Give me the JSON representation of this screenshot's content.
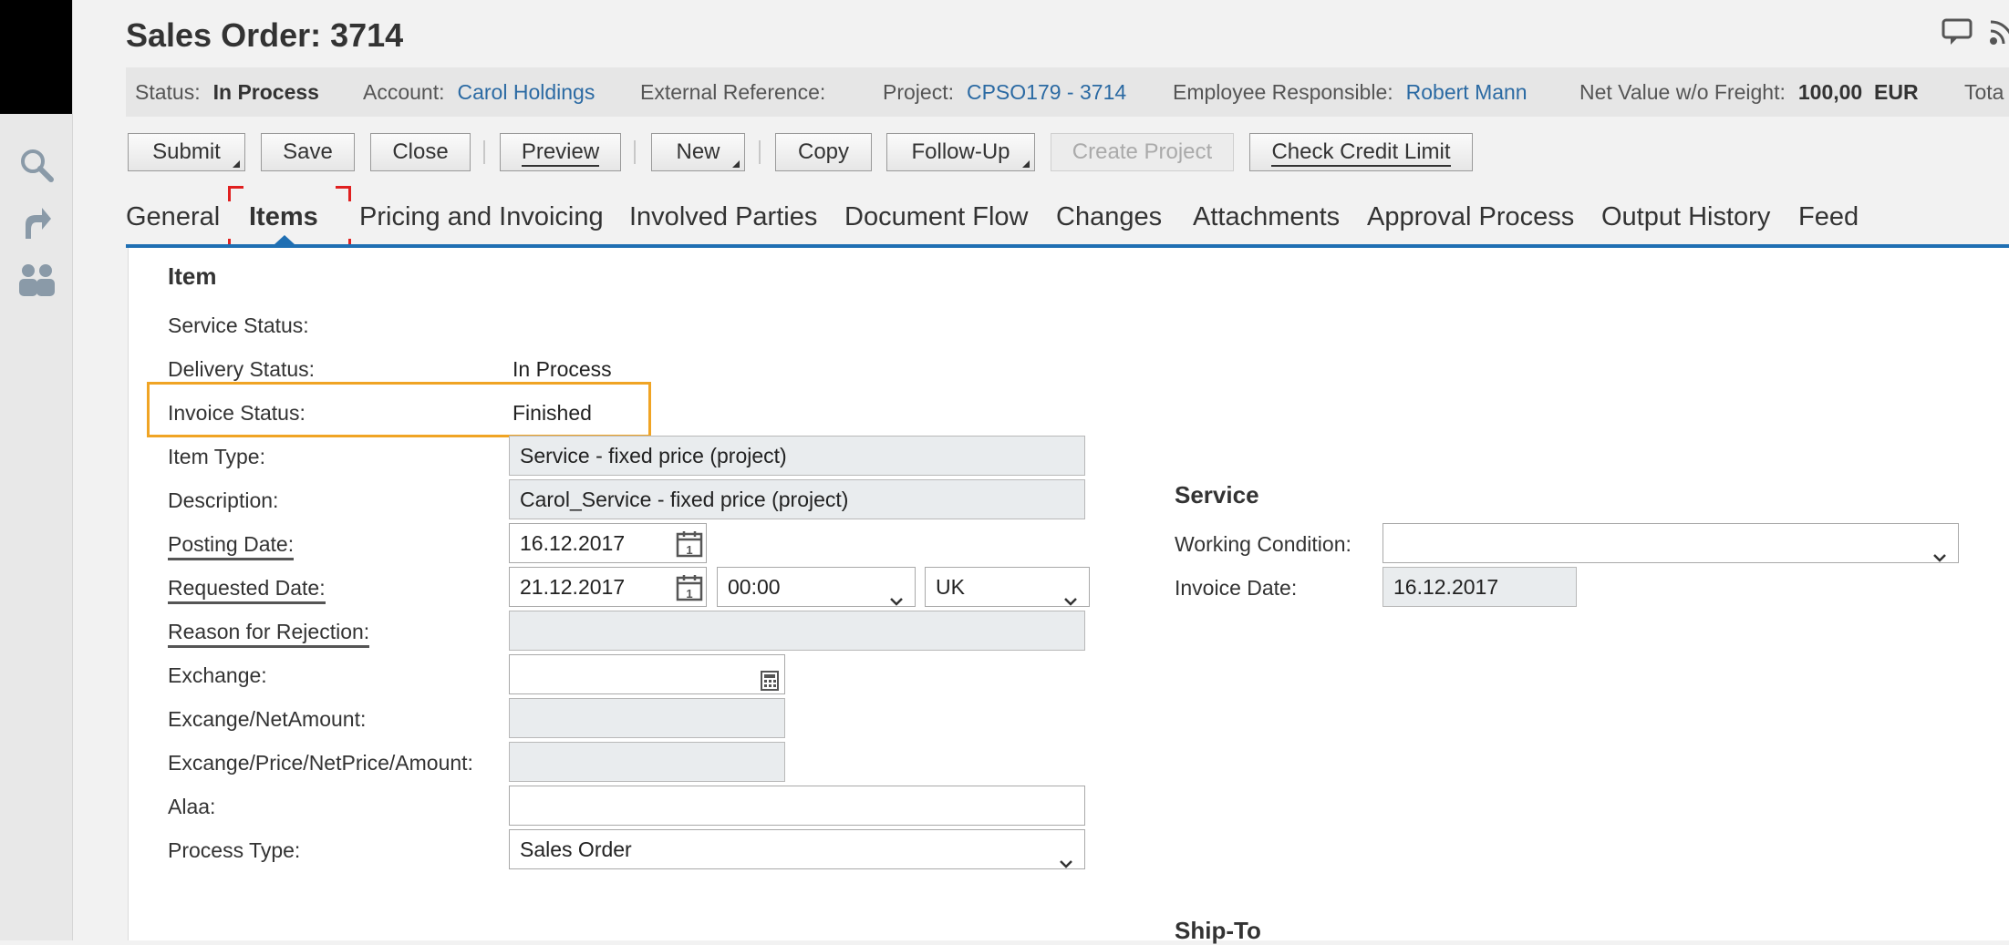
{
  "title": "Sales Order: 3714",
  "header": {
    "status": {
      "label": "Status:",
      "value": "In Process"
    },
    "account": {
      "label": "Account:",
      "value": "Carol Holdings"
    },
    "external_reference": {
      "label": "External Reference:",
      "value": ""
    },
    "project": {
      "label": "Project:",
      "value": "CPSO179 - 3714"
    },
    "employee": {
      "label": "Employee Responsible:",
      "value": "Robert Mann"
    },
    "net_value": {
      "label": "Net Value w/o Freight:",
      "value": "100,00",
      "currency": "EUR"
    },
    "total_partial": "Tota"
  },
  "toolbar": {
    "submit": "Submit",
    "save": "Save",
    "close": "Close",
    "preview": "Preview",
    "new": "New",
    "copy": "Copy",
    "follow_up": "Follow-Up",
    "create_project": "Create Project",
    "check_credit_limit": "Check Credit Limit"
  },
  "tabs": [
    {
      "label": "General"
    },
    {
      "label": "Items"
    },
    {
      "label": "Pricing and Invoicing"
    },
    {
      "label": "Involved Parties"
    },
    {
      "label": "Document Flow"
    },
    {
      "label": "Changes"
    },
    {
      "label": "Attachments"
    },
    {
      "label": "Approval Process"
    },
    {
      "label": "Output History"
    },
    {
      "label": "Feed"
    }
  ],
  "item": {
    "section_title": "Item",
    "service_status": {
      "label": "Service Status:",
      "value": ""
    },
    "delivery_status": {
      "label": "Delivery Status:",
      "value": "In Process"
    },
    "invoice_status": {
      "label": "Invoice Status:",
      "value": "Finished"
    },
    "item_type": {
      "label": "Item Type:",
      "value": "Service - fixed price (project)"
    },
    "description": {
      "label": "Description:",
      "value": "Carol_Service - fixed price (project)"
    },
    "posting_date": {
      "label": "Posting Date:",
      "value": "16.12.2017"
    },
    "requested_date": {
      "label": "Requested Date:",
      "date": "21.12.2017",
      "time": "00:00",
      "timezone": "UK"
    },
    "reason_for_rejection": {
      "label": "Reason for Rejection:",
      "value": ""
    },
    "exchange": {
      "label": "Exchange:",
      "value": ""
    },
    "excange_net_amount": {
      "label": "Excange/NetAmount:",
      "value": ""
    },
    "excange_price": {
      "label": "Excange/Price/NetPrice/Amount:",
      "value": ""
    },
    "alaa": {
      "label": "Alaa:",
      "value": ""
    },
    "process_type": {
      "label": "Process Type:",
      "value": "Sales Order"
    }
  },
  "service": {
    "section_title": "Service",
    "working_condition": {
      "label": "Working Condition:",
      "value": ""
    },
    "invoice_date": {
      "label": "Invoice Date:",
      "value": "16.12.2017"
    }
  },
  "ship_to": {
    "section_title": "Ship-To"
  },
  "icons": {
    "rail": [
      "search-icon",
      "share-icon",
      "people-icon"
    ],
    "top": [
      "chat-icon",
      "rss-icon"
    ]
  },
  "colors": {
    "link": "#2b6aa3",
    "tab_underline": "#1f6fb3",
    "highlight": "#f0a424",
    "focus_marker": "#e02020"
  }
}
